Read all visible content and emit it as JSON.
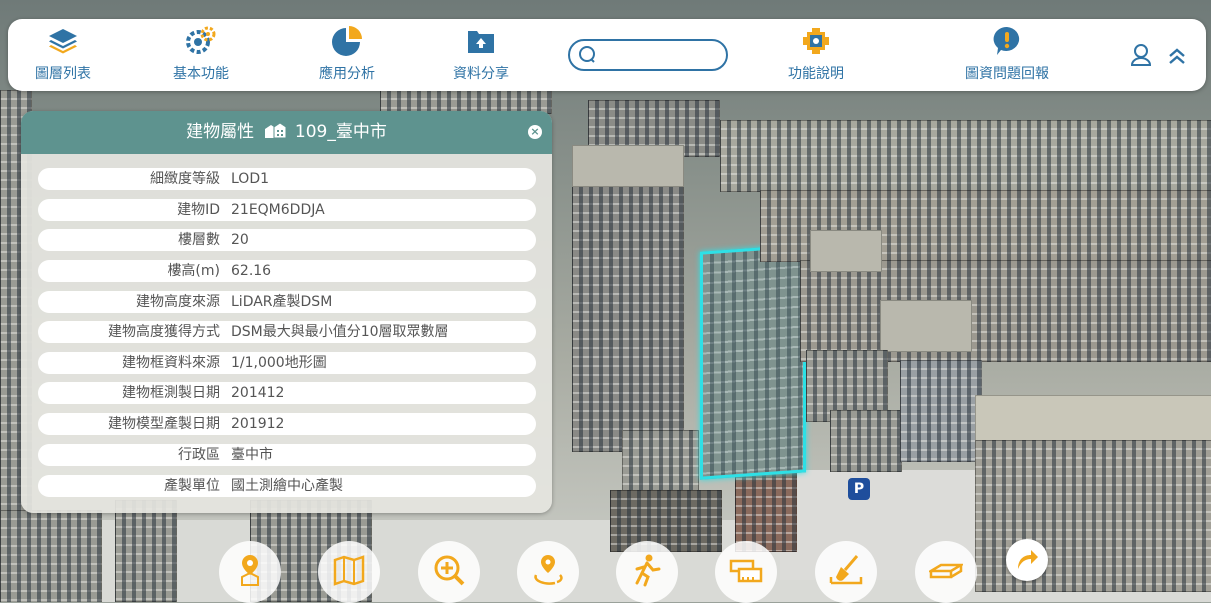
{
  "toolbar": {
    "items": [
      {
        "label": "圖層列表",
        "icon": "layers-icon"
      },
      {
        "label": "基本功能",
        "icon": "gear-icon"
      },
      {
        "label": "應用分析",
        "icon": "pie-chart-icon"
      },
      {
        "label": "資料分享",
        "icon": "upload-folder-icon"
      },
      {
        "label": "功能說明",
        "icon": "puzzle-gear-icon"
      },
      {
        "label": "圖資問題回報",
        "icon": "alert-bubble-icon"
      }
    ],
    "search_placeholder": "",
    "colors": {
      "label": "#2f73a5",
      "icon": "#2f73a5",
      "accent": "#f2a81d"
    }
  },
  "panel": {
    "title": "建物屬性",
    "subtitle": "109_臺中市",
    "header_color": "#5e938f",
    "rows": [
      {
        "key": "細緻度等級",
        "value": "LOD1"
      },
      {
        "key": "建物ID",
        "value": "21EQM6DDJA"
      },
      {
        "key": "樓層數",
        "value": "20"
      },
      {
        "key": "樓高(m)",
        "value": "62.16"
      },
      {
        "key": "建物高度來源",
        "value": "LiDAR產製DSM"
      },
      {
        "key": "建物高度獲得方式",
        "value": "DSM最大與最小值分10層取眾數層"
      },
      {
        "key": "建物框資料來源",
        "value": "1/1,000地形圖"
      },
      {
        "key": "建物框測製日期",
        "value": "201412"
      },
      {
        "key": "建物模型產製日期",
        "value": "201912"
      },
      {
        "key": "行政區",
        "value": "臺中市"
      },
      {
        "key": "產製單位",
        "value": "國土測繪中心產製"
      }
    ]
  },
  "map": {
    "highlight_color": "#2ee0e6",
    "parking_sign": "P"
  },
  "bottom_tools": [
    {
      "name": "locate-building-tool",
      "icon": "pin-building-icon"
    },
    {
      "name": "map-tool",
      "icon": "folded-map-icon"
    },
    {
      "name": "zoom-in-tool",
      "icon": "zoom-in-icon"
    },
    {
      "name": "orbit-tool",
      "icon": "orbit-pin-icon"
    },
    {
      "name": "walk-tool",
      "icon": "walking-person-icon"
    },
    {
      "name": "measure-tool",
      "icon": "ruler-icon"
    },
    {
      "name": "excavate-tool",
      "icon": "shovel-icon"
    },
    {
      "name": "slice-tool",
      "icon": "plane-box-icon"
    }
  ]
}
